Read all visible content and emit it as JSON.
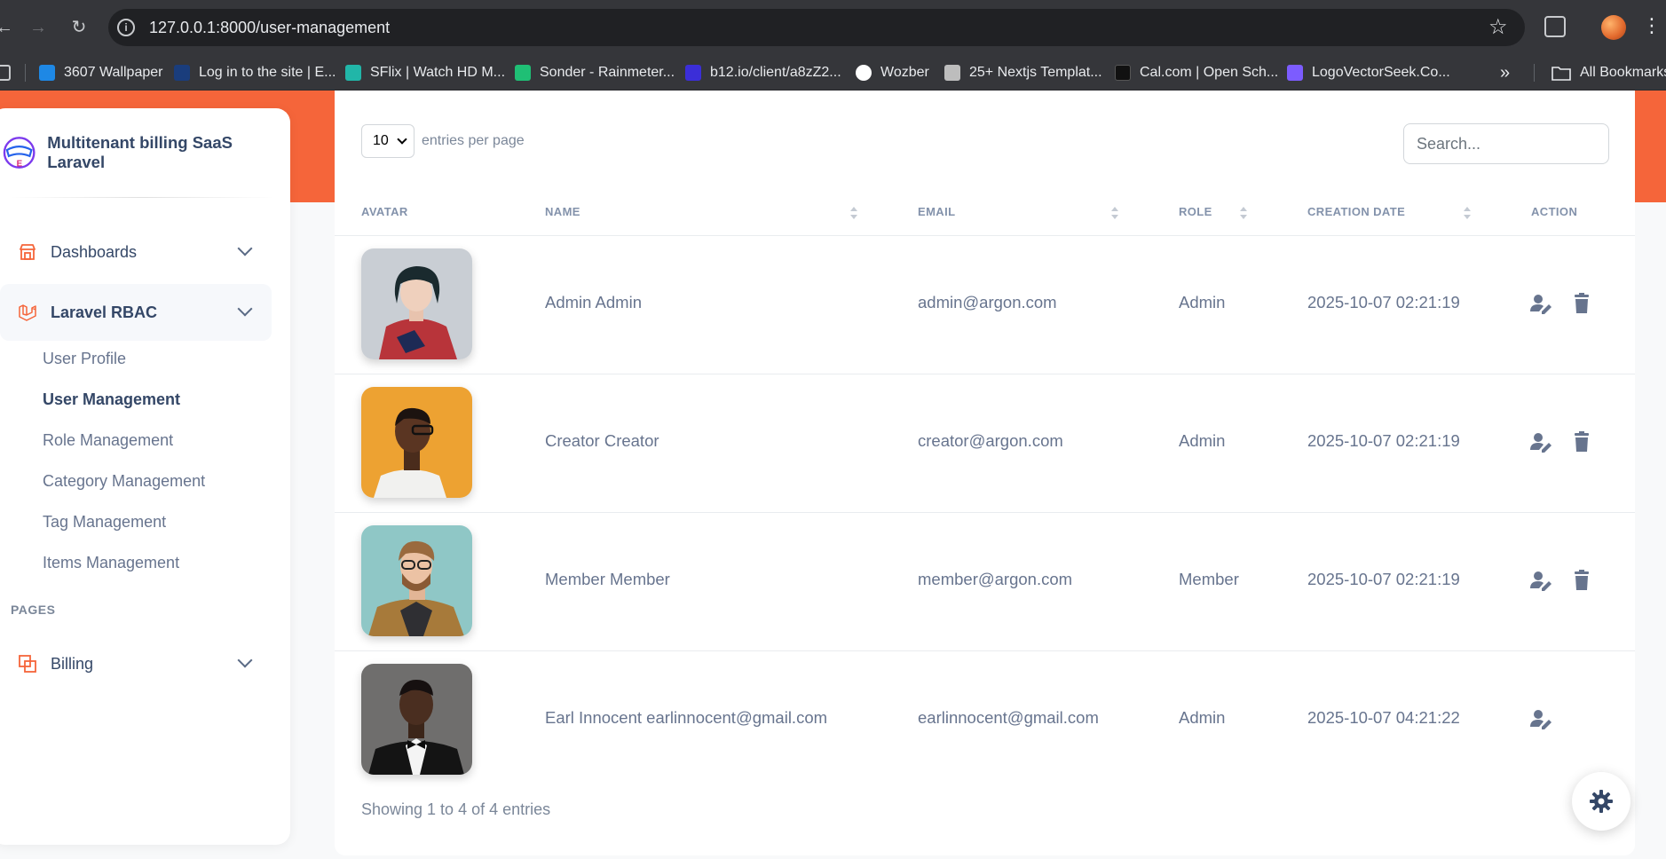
{
  "browser": {
    "url": "127.0.0.1:8000/user-management",
    "bookmarks": [
      {
        "label": "3607 Wallpaper",
        "color": "#1e88e5"
      },
      {
        "label": "Log in to the site | E...",
        "color": "#1a3d7c"
      },
      {
        "label": "SFlix | Watch HD M...",
        "color": "#21b6a8"
      },
      {
        "label": "Sonder - Rainmeter...",
        "color": "#1fbf75"
      },
      {
        "label": "b12.io/client/a8zZ2...",
        "color": "#3b2ed8"
      },
      {
        "label": "Wozber",
        "color": "#ffffff"
      },
      {
        "label": "25+ Nextjs Templat...",
        "color": "#bdbdbd"
      },
      {
        "label": "Cal.com | Open Sch...",
        "color": "#111111"
      },
      {
        "label": "LogoVectorSeek.Co...",
        "color": "#7c5cff"
      }
    ],
    "more_label": "»",
    "all_bookmarks": "All Bookmarks"
  },
  "sidebar": {
    "brand": "Multitenant billing SaaS Laravel",
    "nav": {
      "dashboards": "Dashboards",
      "laravel_rbac": "Laravel RBAC",
      "billing": "Billing"
    },
    "sub_items": [
      "User Profile",
      "User Management",
      "Role Management",
      "Category Management",
      "Tag Management",
      "Items Management"
    ],
    "pages_title": "PAGES",
    "accent": "#f5653a"
  },
  "table": {
    "per_page_value": "10",
    "per_page_label": "entries per page",
    "search_placeholder": "Search...",
    "columns": [
      "AVATAR",
      "NAME",
      "EMAIL",
      "ROLE",
      "CREATION DATE",
      "ACTION"
    ],
    "rows": [
      {
        "name": "Admin Admin",
        "email": "admin@argon.com",
        "role": "Admin",
        "created": "2025-10-07 02:21:19",
        "avatar": "woman-red-jacket",
        "deletable": true
      },
      {
        "name": "Creator Creator",
        "email": "creator@argon.com",
        "role": "Admin",
        "created": "2025-10-07 02:21:19",
        "avatar": "man-glasses-orange-bg",
        "deletable": true
      },
      {
        "name": "Member Member",
        "email": "member@argon.com",
        "role": "Member",
        "created": "2025-10-07 02:21:19",
        "avatar": "man-beard-glasses-teal-bg",
        "deletable": true
      },
      {
        "name": "Earl Innocent earlinnocent@gmail.com",
        "email": "earlinnocent@gmail.com",
        "role": "Admin",
        "created": "2025-10-07 04:21:22",
        "avatar": "man-bowtie-gray-bg",
        "deletable": false
      }
    ],
    "footer": "Showing 1 to 4 of 4 entries"
  },
  "icons": {
    "edit": "user-edit-icon",
    "delete": "trash-icon",
    "settings": "gear-icon"
  }
}
